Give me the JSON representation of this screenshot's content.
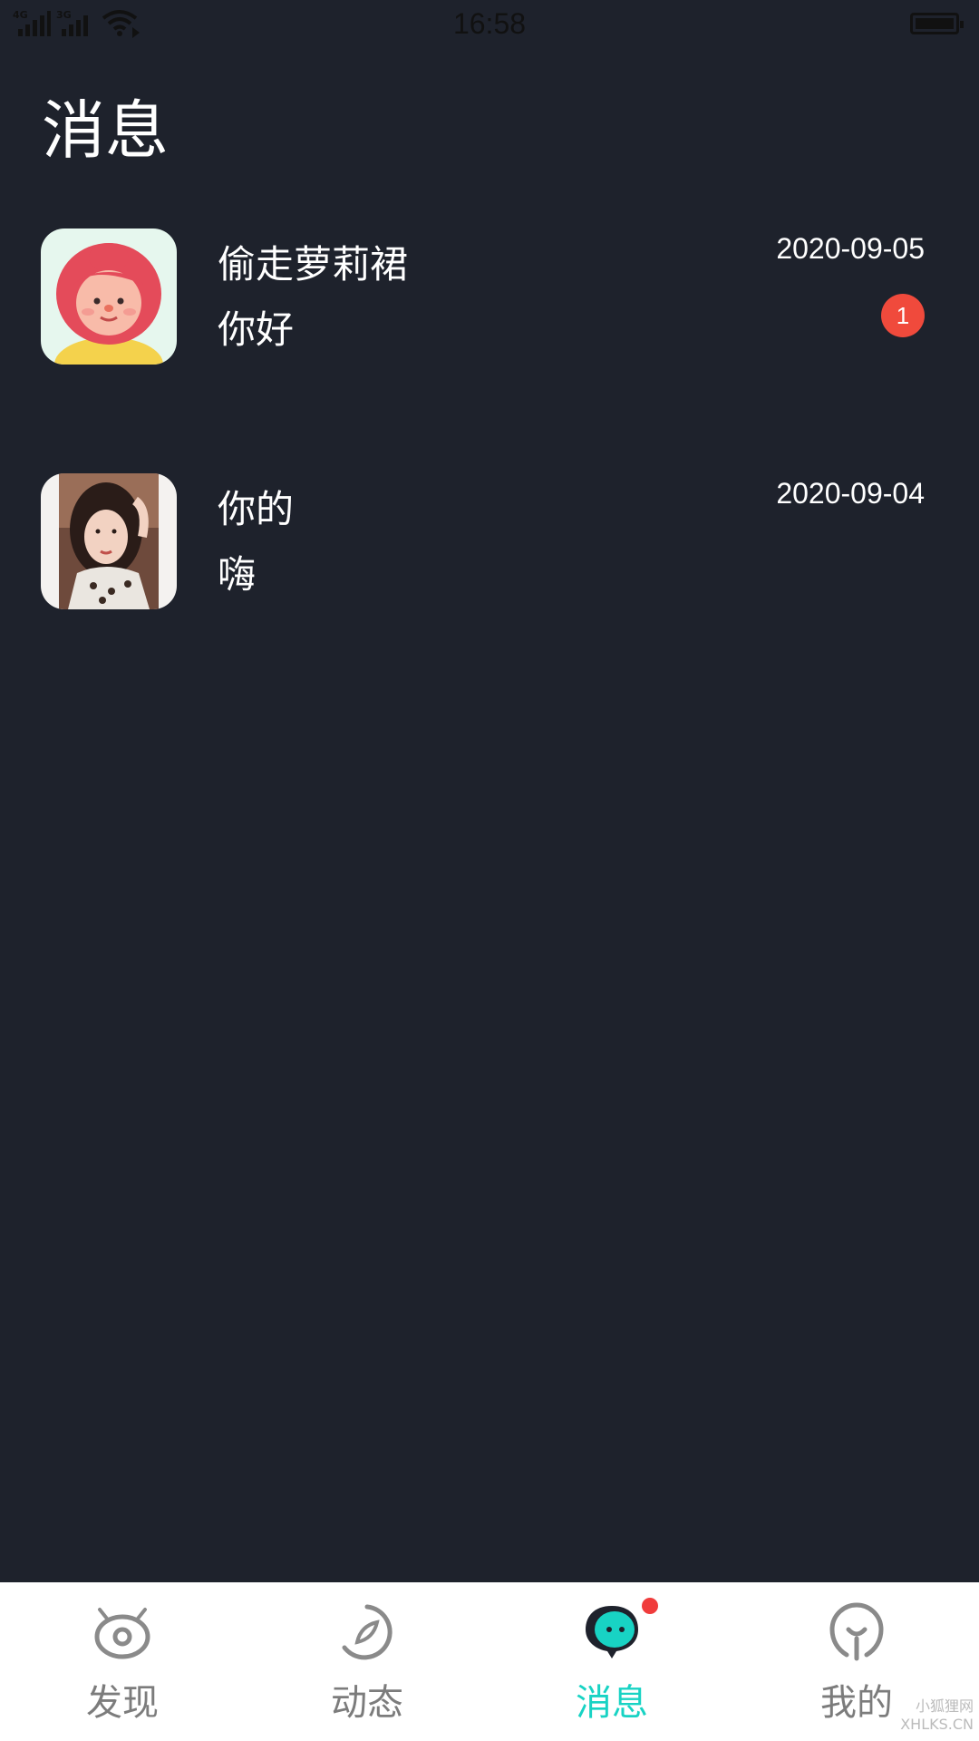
{
  "status_bar": {
    "time": "16:58",
    "signal1": "4G",
    "signal2": "3G"
  },
  "page": {
    "title": "消息"
  },
  "conversations": [
    {
      "name": "偷走萝莉裙",
      "preview": "你好",
      "date": "2020-09-05",
      "unread": "1",
      "avatar": "cartoon-girl-avatar"
    },
    {
      "name": "你的",
      "preview": "嗨",
      "date": "2020-09-04",
      "avatar": "photo-avatar"
    }
  ],
  "tabs": [
    {
      "label": "发现",
      "icon": "eye-icon"
    },
    {
      "label": "动态",
      "icon": "compass-icon"
    },
    {
      "label": "消息",
      "icon": "chat-bubble-icon",
      "active": true
    },
    {
      "label": "我的",
      "icon": "profile-icon"
    }
  ],
  "colors": {
    "background": "#1e222c",
    "accent": "#18d3c4",
    "badge": "#f04a3c",
    "tabbar": "#ffffff"
  },
  "watermark": {
    "line1": "小狐狸网",
    "line2": "XHLKS.CN"
  }
}
